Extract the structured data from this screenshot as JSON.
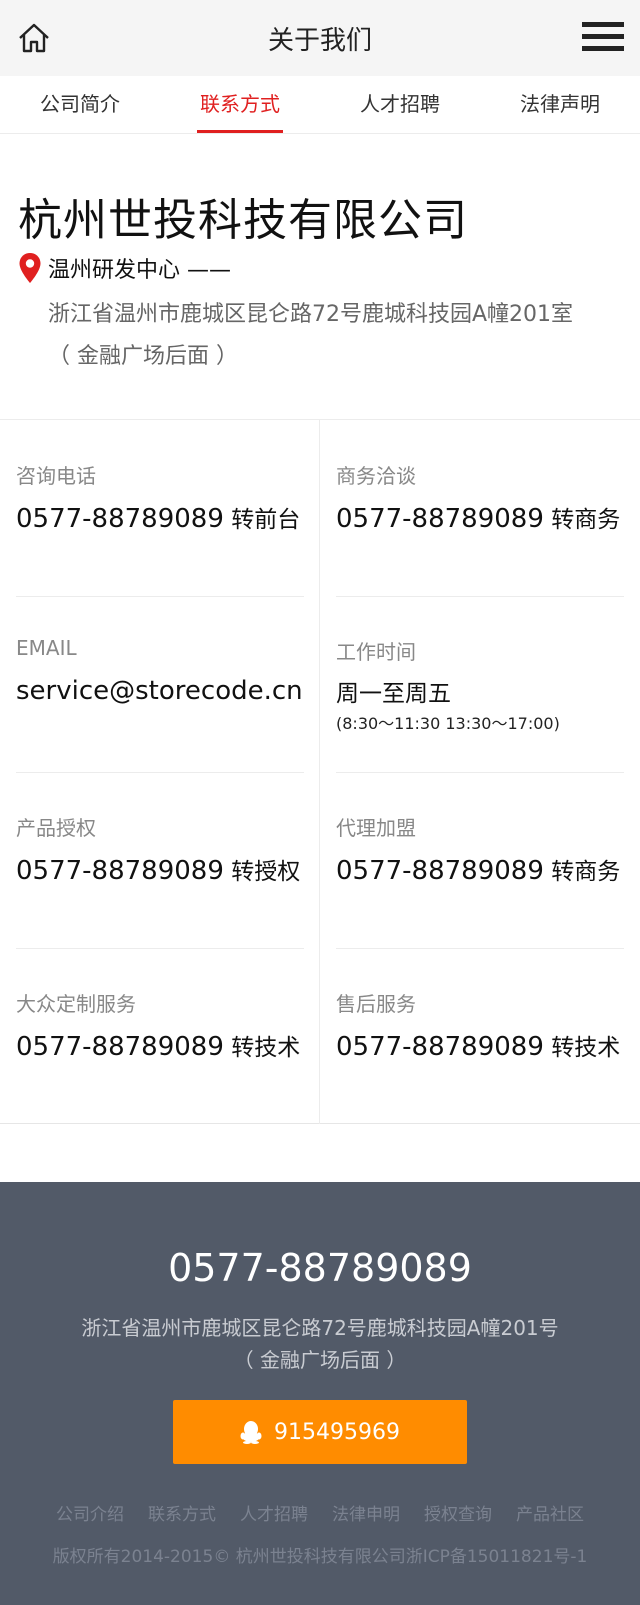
{
  "header": {
    "title": "关于我们",
    "home_icon": "home-icon",
    "menu_icon": "hamburger-menu-icon"
  },
  "tabs": [
    {
      "label": "公司简介",
      "active": false
    },
    {
      "label": "联系方式",
      "active": true
    },
    {
      "label": "人才招聘",
      "active": false
    },
    {
      "label": "法律声明",
      "active": false
    }
  ],
  "company": {
    "name": "杭州世投科技有限公司",
    "branch": "温州研发中心 ——",
    "address_line1": "浙江省温州市鹿城区昆仑路72号鹿城科技园A幢201室",
    "address_line2": "（ 金融广场后面 ）"
  },
  "contacts": [
    {
      "label": "咨询电话",
      "value": "0577-88789089",
      "suffix": " 转前台"
    },
    {
      "label": "商务洽谈",
      "value": "0577-88789089",
      "suffix": " 转商务"
    },
    {
      "label": "EMAIL",
      "value": "service@storecode.cn",
      "suffix": ""
    },
    {
      "label": "工作时间",
      "value": "周一至周五",
      "suffix": "",
      "sub": "(8:30～11:30 13:30～17:00)"
    },
    {
      "label": "产品授权",
      "value": "0577-88789089",
      "suffix": " 转授权"
    },
    {
      "label": "代理加盟",
      "value": "0577-88789089",
      "suffix": " 转商务"
    },
    {
      "label": "大众定制服务",
      "value": "0577-88789089",
      "suffix": " 转技术"
    },
    {
      "label": "售后服务",
      "value": "0577-88789089",
      "suffix": " 转技术"
    }
  ],
  "footer": {
    "phone": "0577-88789089",
    "address_line1": "浙江省温州市鹿城区昆仑路72号鹿城科技园A幢201号",
    "address_line2": "（ 金融广场后面 ）",
    "qq_label": "915495969",
    "links": [
      "公司介绍",
      "联系方式",
      "人才招聘",
      "法律申明",
      "授权查询",
      "产品社区"
    ],
    "copyright": "版权所有2014-2015© 杭州世投科技有限公司浙ICP备15011821号-1"
  },
  "colors": {
    "accent": "#e02020",
    "footer_bg": "#525a68",
    "qq_button": "#ff8c00"
  }
}
